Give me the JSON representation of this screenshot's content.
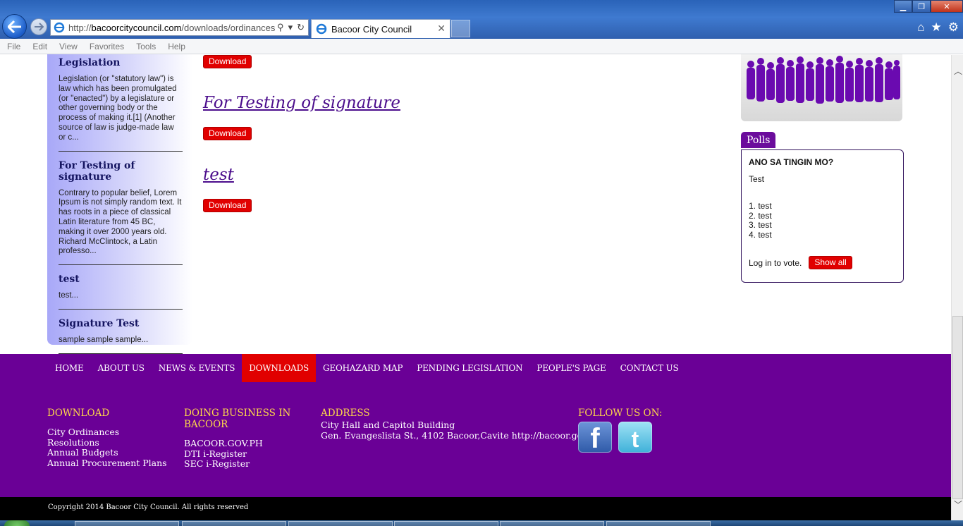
{
  "browser": {
    "url_prefix": "http://",
    "url_domain": "bacoorcitycouncil.com",
    "url_path": "/downloads/ordinances",
    "tab_title": "Bacoor City Council",
    "menu": [
      "File",
      "Edit",
      "View",
      "Favorites",
      "Tools",
      "Help"
    ]
  },
  "sidebar": {
    "items": [
      {
        "title": "Legislation",
        "excerpt": "Legislation (or \"statutory law\") is law which has been promulgated (or \"enacted\") by a legislature or other governing body or the process of making it.[1] (Another source of law is judge-made law or c..."
      },
      {
        "title": "For Testing of signature",
        "excerpt": "Contrary to popular belief, Lorem Ipsum is not simply random text. It has roots in a piece of classical Latin literature from 45 BC, making it over 2000 years old. Richard McClintock, a Latin professo..."
      },
      {
        "title": "test",
        "excerpt": "test..."
      },
      {
        "title": "Signature Test",
        "excerpt": "sample sample sample..."
      }
    ]
  },
  "main": {
    "download_label": "Download",
    "documents": [
      {
        "title": "For Testing of signature"
      },
      {
        "title": "test"
      }
    ]
  },
  "polls": {
    "tab_label": "Polls",
    "question": "ANO SA TINGIN MO?",
    "subtitle": "Test",
    "options": [
      "1. test",
      "2. test",
      "3. test",
      "4. test"
    ],
    "login_text": "Log in to vote.",
    "show_all_label": "Show all"
  },
  "footer": {
    "nav": [
      "HOME",
      "ABOUT US",
      "NEWS & EVENTS",
      "DOWNLOADS",
      "GEOHAZARD MAP",
      "PENDING LEGISLATION",
      "PEOPLE'S PAGE",
      "CONTACT US"
    ],
    "active_nav": "DOWNLOADS",
    "download": {
      "heading": "DOWNLOAD",
      "links": [
        "City Ordinances",
        "Resolutions",
        "Annual Budgets",
        "Annual Procurement Plans"
      ]
    },
    "business": {
      "heading": "DOING BUSINESS IN BACOOR",
      "links": [
        "BACOOR.GOV.PH",
        "DTI i-Register",
        "SEC i-Register"
      ]
    },
    "address": {
      "heading": "ADDRESS",
      "line1": "City Hall and Capitol Building",
      "line2": "Gen. Evangeslista St., 4102 Bacoor,Cavite http://bacoor.gov.ph"
    },
    "follow": {
      "heading": "FOLLOW US ON:",
      "facebook_glyph": "f",
      "twitter_glyph": "t"
    },
    "copyright": "Copyright 2014 Bacoor City Council. All rights reserved"
  },
  "colors": {
    "brand_purple": "#6a0096",
    "download_red": "#e10000",
    "footer_heading": "#ffd84a"
  }
}
